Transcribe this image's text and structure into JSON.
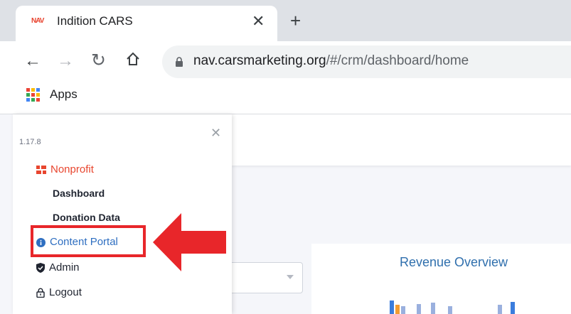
{
  "browser": {
    "tab": {
      "favicon": "NAV",
      "title": "Indition CARS"
    },
    "url": {
      "host": "nav.carsmarketing.org",
      "path": "/#/crm/dashboard/home"
    },
    "bookmarks": {
      "apps_label": "Apps"
    },
    "icons": [
      "back-arrow-icon",
      "forward-arrow-icon",
      "reload-icon",
      "home-icon",
      "lock-icon",
      "apps-grid-icon",
      "close-icon",
      "plus-icon"
    ]
  },
  "sidebar": {
    "version": "1.17.8",
    "nonprofit": {
      "label": "Nonprofit",
      "icon": "grid-icon",
      "color": "#e8462f"
    },
    "sub_items": [
      {
        "label": "Dashboard"
      },
      {
        "label": "Donation Data"
      }
    ],
    "content_portal": {
      "label": "Content Portal",
      "icon": "info-circle-icon",
      "color": "#2f6fc1"
    },
    "admin": {
      "label": "Admin",
      "icon": "shield-check-icon"
    },
    "logout": {
      "label": "Logout",
      "icon": "lock-icon"
    }
  },
  "main": {
    "revenue_card": {
      "title": "Revenue Overview"
    }
  },
  "annotation": {
    "highlight_color": "#e8262a"
  }
}
